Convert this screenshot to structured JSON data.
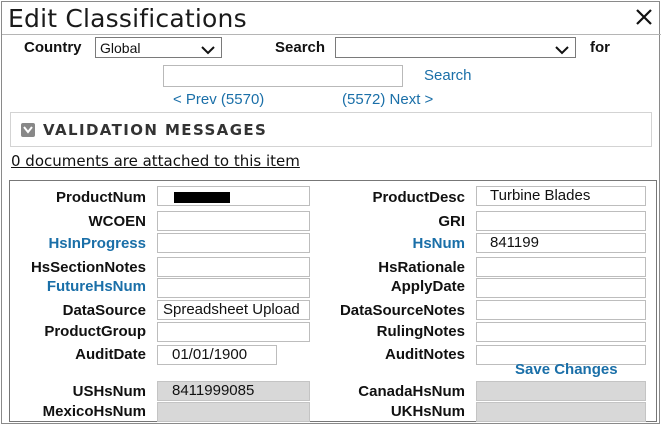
{
  "window": {
    "title": "Edit Classifications"
  },
  "toolbar": {
    "country_label": "Country",
    "country_value": "Global",
    "search_label": "Search",
    "search_value": "",
    "for_label": "for",
    "search_text": "",
    "search_button": "Search",
    "prev_link": "< Prev (5570)",
    "next_link": "(5572) Next >"
  },
  "validation": {
    "title": "VALIDATION MESSAGES"
  },
  "attachments": {
    "text": "0 documents are attached to this item"
  },
  "form": {
    "left": [
      {
        "label": "ProductNum",
        "value": "",
        "redacted": true
      },
      {
        "label": "WCOEN",
        "value": ""
      },
      {
        "label": "HsInProgress",
        "value": "",
        "link": true
      },
      {
        "label": "HsSectionNotes",
        "value": ""
      },
      {
        "label": "FutureHsNum",
        "value": "",
        "link": true
      },
      {
        "label": "DataSource",
        "value": "Spreadsheet Upload"
      },
      {
        "label": "ProductGroup",
        "value": ""
      },
      {
        "label": "AuditDate",
        "value": "01/01/1900"
      },
      {
        "label": "USHsNum",
        "value": "8411999085",
        "readonly": true
      },
      {
        "label": "MexicoHsNum",
        "value": "",
        "readonly": true
      }
    ],
    "right": [
      {
        "label": "ProductDesc",
        "value": "Turbine Blades"
      },
      {
        "label": "GRI",
        "value": ""
      },
      {
        "label": "HsNum",
        "value": "841199",
        "link": true
      },
      {
        "label": "HsRationale",
        "value": ""
      },
      {
        "label": "ApplyDate",
        "value": ""
      },
      {
        "label": "DataSourceNotes",
        "value": ""
      },
      {
        "label": "RulingNotes",
        "value": ""
      },
      {
        "label": "AuditNotes",
        "value": ""
      },
      {
        "label": "CanadaHsNum",
        "value": "",
        "readonly": true
      },
      {
        "label": "UKHsNum",
        "value": "",
        "readonly": true
      }
    ],
    "save_label": "Save Changes"
  },
  "colors": {
    "link": "#1a6fa8",
    "readonly_bg": "#d8d8d8"
  }
}
